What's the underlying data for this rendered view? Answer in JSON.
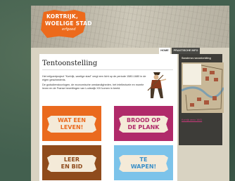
{
  "site": {
    "logo_line1": "KORTRIJK,",
    "logo_line2": "WOELIGE STAD",
    "logo_tagline": "erfgoed",
    "accent_color": "#ec6a1c"
  },
  "nav": {
    "tabs": [
      {
        "label": "HOME",
        "active": true
      },
      {
        "label": "PRAKTISCHE INFO",
        "active": false
      }
    ]
  },
  "main": {
    "title": "Tentoonstelling",
    "intro": "Het erfgoedproject \"Kortrijk, woelige stad\" vergt een licht op de periode 1580-1680 in de eigen geschiedenis.",
    "body": "De godsdienstoorlogen, de economische omstandigheden, het intellectuele en morele leven en de Franse bezettingen van Lodewijk XIV komen in beeld.",
    "tiles": [
      {
        "line1": "WAT EEN",
        "line2": "LEVEN!",
        "color": "#ea6a1e"
      },
      {
        "line1": "BROOD OP",
        "line2": "DE PLANK",
        "color": "#b02a6a"
      },
      {
        "line1": "LEER",
        "line2": "EN BID",
        "color": "#8f4b1c"
      },
      {
        "line1": "TE",
        "line2": "WAPEN!",
        "color": "#7cc3ea"
      }
    ]
  },
  "sidebar": {
    "title": "Sanderus woonbeiding",
    "map_caption": "Kortrijk anno 1641"
  }
}
